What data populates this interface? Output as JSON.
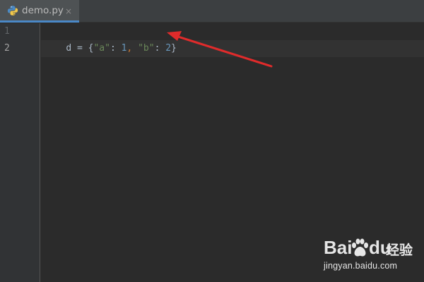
{
  "tab": {
    "filename": "demo.py",
    "close_glyph": "×",
    "icon": "python-file-icon"
  },
  "gutter": {
    "line_numbers": [
      "1",
      "2"
    ]
  },
  "code": {
    "line1_tokens": [
      {
        "text": "d",
        "kind": "id"
      },
      {
        "text": " = ",
        "kind": "op"
      },
      {
        "text": "{",
        "kind": "op"
      },
      {
        "text": "\"a\"",
        "kind": "str"
      },
      {
        "text": ": ",
        "kind": "op"
      },
      {
        "text": "1",
        "kind": "num"
      },
      {
        "text": ", ",
        "kind": "punc"
      },
      {
        "text": "\"b\"",
        "kind": "str"
      },
      {
        "text": ": ",
        "kind": "op"
      },
      {
        "text": "2",
        "kind": "num"
      },
      {
        "text": "}",
        "kind": "op"
      }
    ]
  },
  "watermark": {
    "brand_left": "Bai",
    "brand_right": "du",
    "product": "经验",
    "url": "jingyan.baidu.com"
  },
  "colors": {
    "editor_bg": "#2b2b2b",
    "gutter_bg": "#313335",
    "tab_active_bg": "#4e5254",
    "tab_underline": "#4a88c7",
    "arrow": "#e02b2b",
    "string": "#6a8759",
    "number": "#6897bb",
    "identifier": "#a9b7c6"
  }
}
